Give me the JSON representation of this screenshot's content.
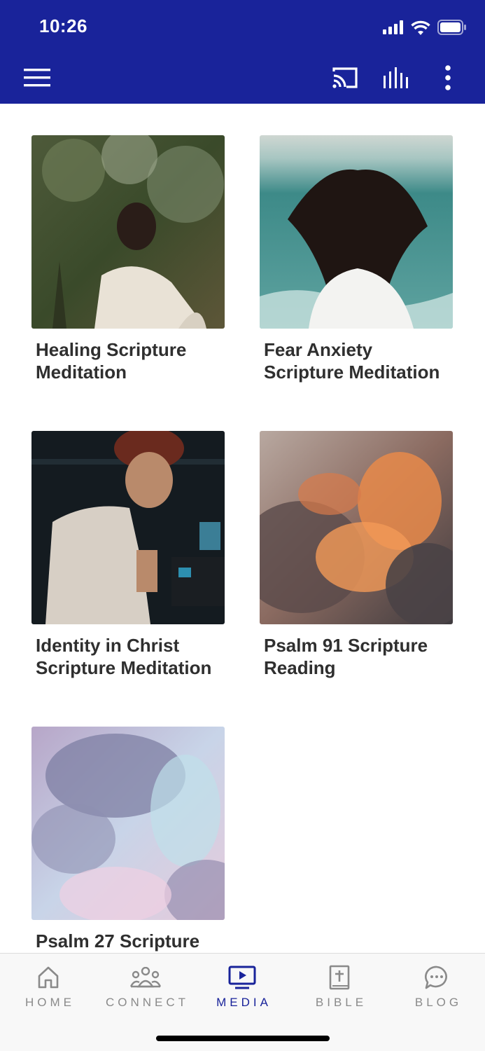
{
  "status_bar": {
    "time": "10:26"
  },
  "toolbar": {
    "menu_icon": "hamburger-menu-icon",
    "cast_icon": "cast-icon",
    "audio_icon": "audio-bars-icon",
    "more_icon": "more-vertical-icon"
  },
  "media_items": [
    {
      "title": "Healing Scripture Meditation"
    },
    {
      "title": "Fear Anxiety Scripture Meditation"
    },
    {
      "title": "Identity in Christ Scripture Meditation"
    },
    {
      "title": "Psalm 91 Scripture Reading"
    },
    {
      "title": "Psalm 27 Scripture"
    }
  ],
  "bottom_nav": {
    "items": [
      {
        "label": "HOME",
        "icon": "home-icon"
      },
      {
        "label": "CONNECT",
        "icon": "people-icon"
      },
      {
        "label": "MEDIA",
        "icon": "tv-play-icon"
      },
      {
        "label": "BIBLE",
        "icon": "bible-icon"
      },
      {
        "label": "BLOG",
        "icon": "chat-bubble-icon"
      }
    ],
    "active": "MEDIA"
  },
  "colors": {
    "primary": "#19239a",
    "title_text": "#2f2f2f",
    "nav_inactive": "#8a8a8a"
  }
}
